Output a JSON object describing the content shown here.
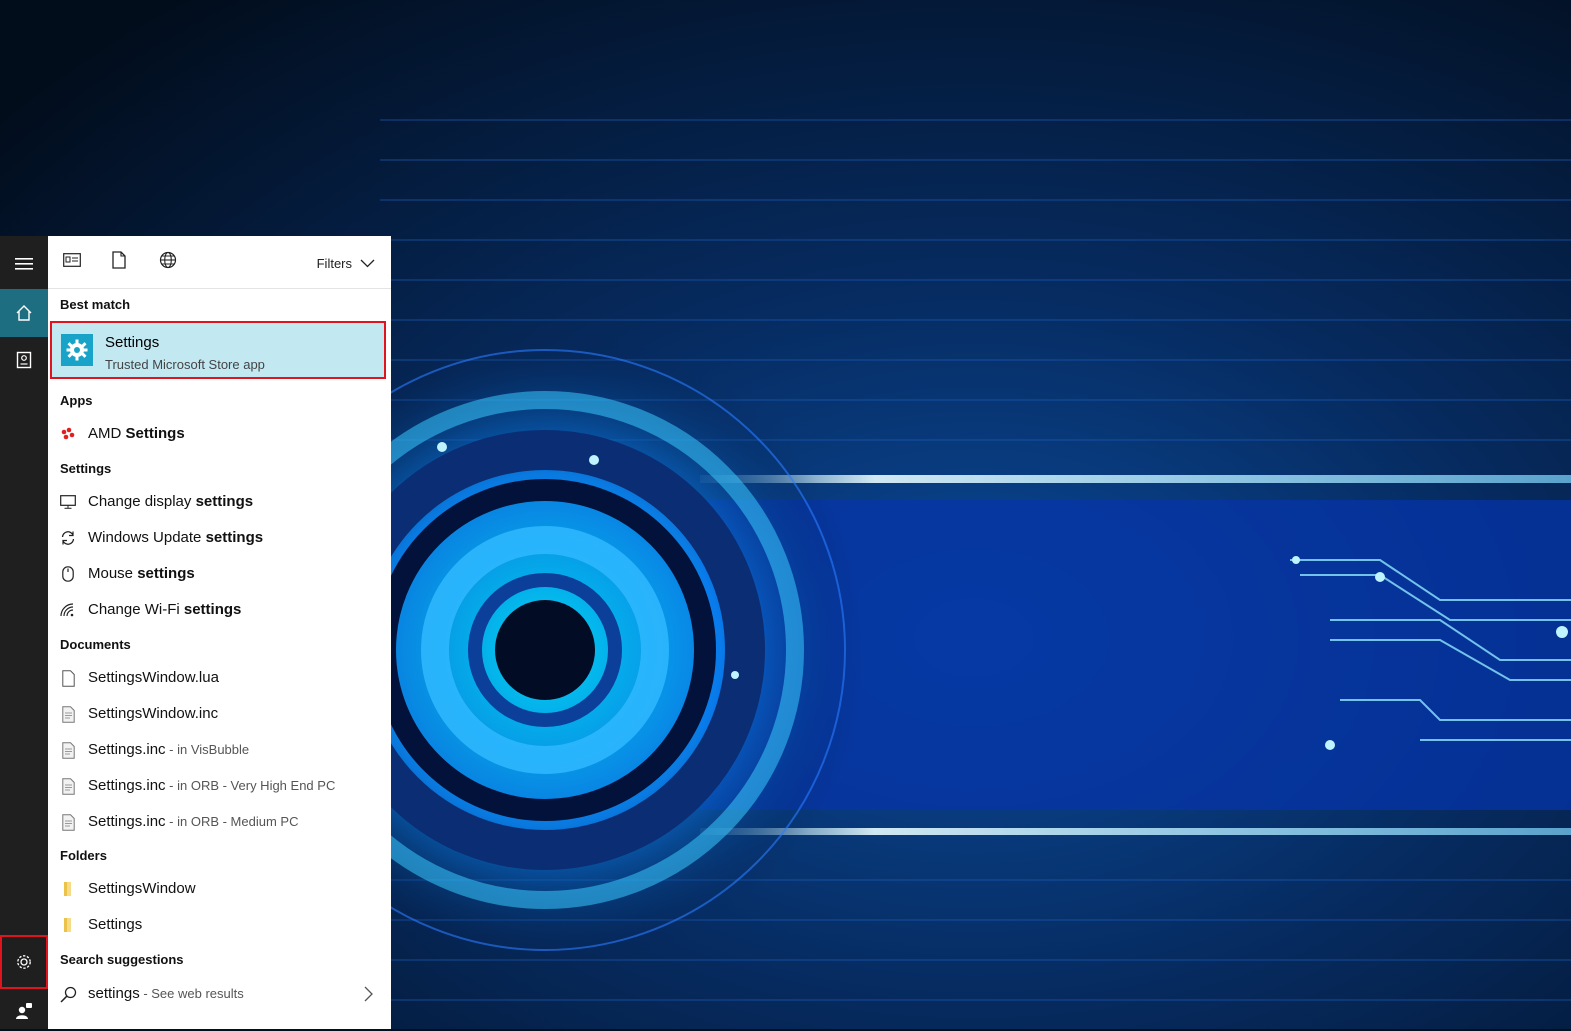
{
  "toolbar": {
    "icons": [
      "apps-filter-icon",
      "documents-filter-icon",
      "web-filter-icon"
    ],
    "filters_label": "Filters"
  },
  "sections": {
    "best_match": "Best match",
    "apps": "Apps",
    "settings": "Settings",
    "documents": "Documents",
    "folders": "Folders",
    "suggestions": "Search suggestions"
  },
  "best_match": {
    "title": "Settings",
    "subtitle": "Trusted Microsoft Store app",
    "icon": "settings-gear-icon"
  },
  "apps": [
    {
      "pre": "AMD ",
      "bold": "Settings",
      "icon": "amd-icon"
    }
  ],
  "settings": [
    {
      "pre": "Change display ",
      "bold": "settings",
      "icon": "monitor-icon"
    },
    {
      "pre": "Windows Update ",
      "bold": "settings",
      "icon": "sync-icon"
    },
    {
      "pre": "Mouse ",
      "bold": "settings",
      "icon": "mouse-icon"
    },
    {
      "pre": "Change Wi-Fi ",
      "bold": "settings",
      "icon": "wifi-icon"
    }
  ],
  "documents": [
    {
      "name": "SettingsWindow.lua",
      "location": "",
      "icon": "file-icon"
    },
    {
      "name": "SettingsWindow.inc",
      "location": "",
      "icon": "code-file-icon"
    },
    {
      "name": "Settings.inc",
      "location": " - in VisBubble",
      "icon": "code-file-icon"
    },
    {
      "name": "Settings.inc",
      "location": " - in ORB - Very High End PC",
      "icon": "code-file-icon"
    },
    {
      "name": "Settings.inc",
      "location": " - in ORB - Medium PC",
      "icon": "code-file-icon"
    }
  ],
  "folders": [
    {
      "name": "SettingsWindow",
      "icon": "folder-icon"
    },
    {
      "name": "Settings",
      "icon": "folder-icon"
    }
  ],
  "suggestion": {
    "term": "settings",
    "hint": " - See web results",
    "icon": "search-icon"
  },
  "rail": {
    "items": [
      "hamburger-menu-icon",
      "home-icon",
      "notebook-icon",
      "settings-gear-icon",
      "feedback-icon"
    ]
  },
  "colors": {
    "accent": "#1c6e80",
    "best_match_bg": "#c2e8f2",
    "highlight_border": "#e0141e",
    "rail_bg": "#1f1f1f"
  }
}
